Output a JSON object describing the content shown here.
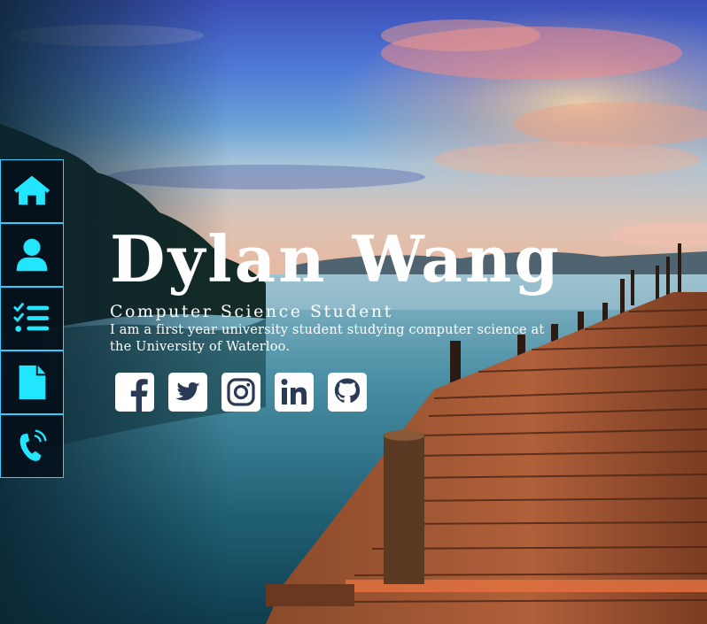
{
  "nav": {
    "items": [
      {
        "label": "Home",
        "icon": "home-icon"
      },
      {
        "label": "About",
        "icon": "user-icon"
      },
      {
        "label": "Experience",
        "icon": "checklist-icon"
      },
      {
        "label": "Resume",
        "icon": "document-icon"
      },
      {
        "label": "Contact",
        "icon": "phone-icon"
      }
    ],
    "accent_color": "#2fd0ff"
  },
  "hero": {
    "name": "Dylan Wang",
    "subtitle": "Computer Science Student",
    "bio": "I am a first year university student studying computer science at the University of Waterloo."
  },
  "socials": [
    {
      "icon": "facebook-icon"
    },
    {
      "icon": "twitter-icon"
    },
    {
      "icon": "instagram-icon"
    },
    {
      "icon": "linkedin-icon"
    },
    {
      "icon": "github-icon"
    }
  ],
  "colors": {
    "text": "#ffffff",
    "sidebar_bg": "#050f19"
  }
}
